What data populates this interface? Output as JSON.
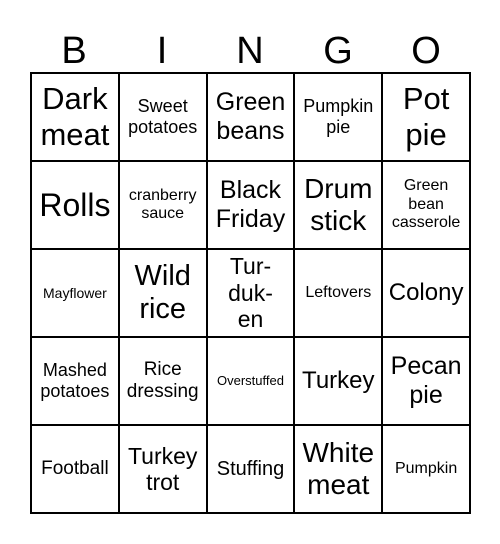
{
  "header": [
    "B",
    "I",
    "N",
    "G",
    "O"
  ],
  "cells": [
    "Dark meat",
    "Sweet potatoes",
    "Green beans",
    "Pumpkin pie",
    "Pot pie",
    "Rolls",
    "cranberry sauce",
    "Black Friday",
    "Drum stick",
    "Green bean casserole",
    "Mayflower",
    "Wild rice",
    "Tur-duk-en",
    "Leftovers",
    "Colony",
    "Mashed potatoes",
    "Rice dressing",
    "Overstuffed",
    "Turkey",
    "Pecan pie",
    "Football",
    "Turkey trot",
    "Stuffing",
    "White meat",
    "Pumpkin"
  ]
}
